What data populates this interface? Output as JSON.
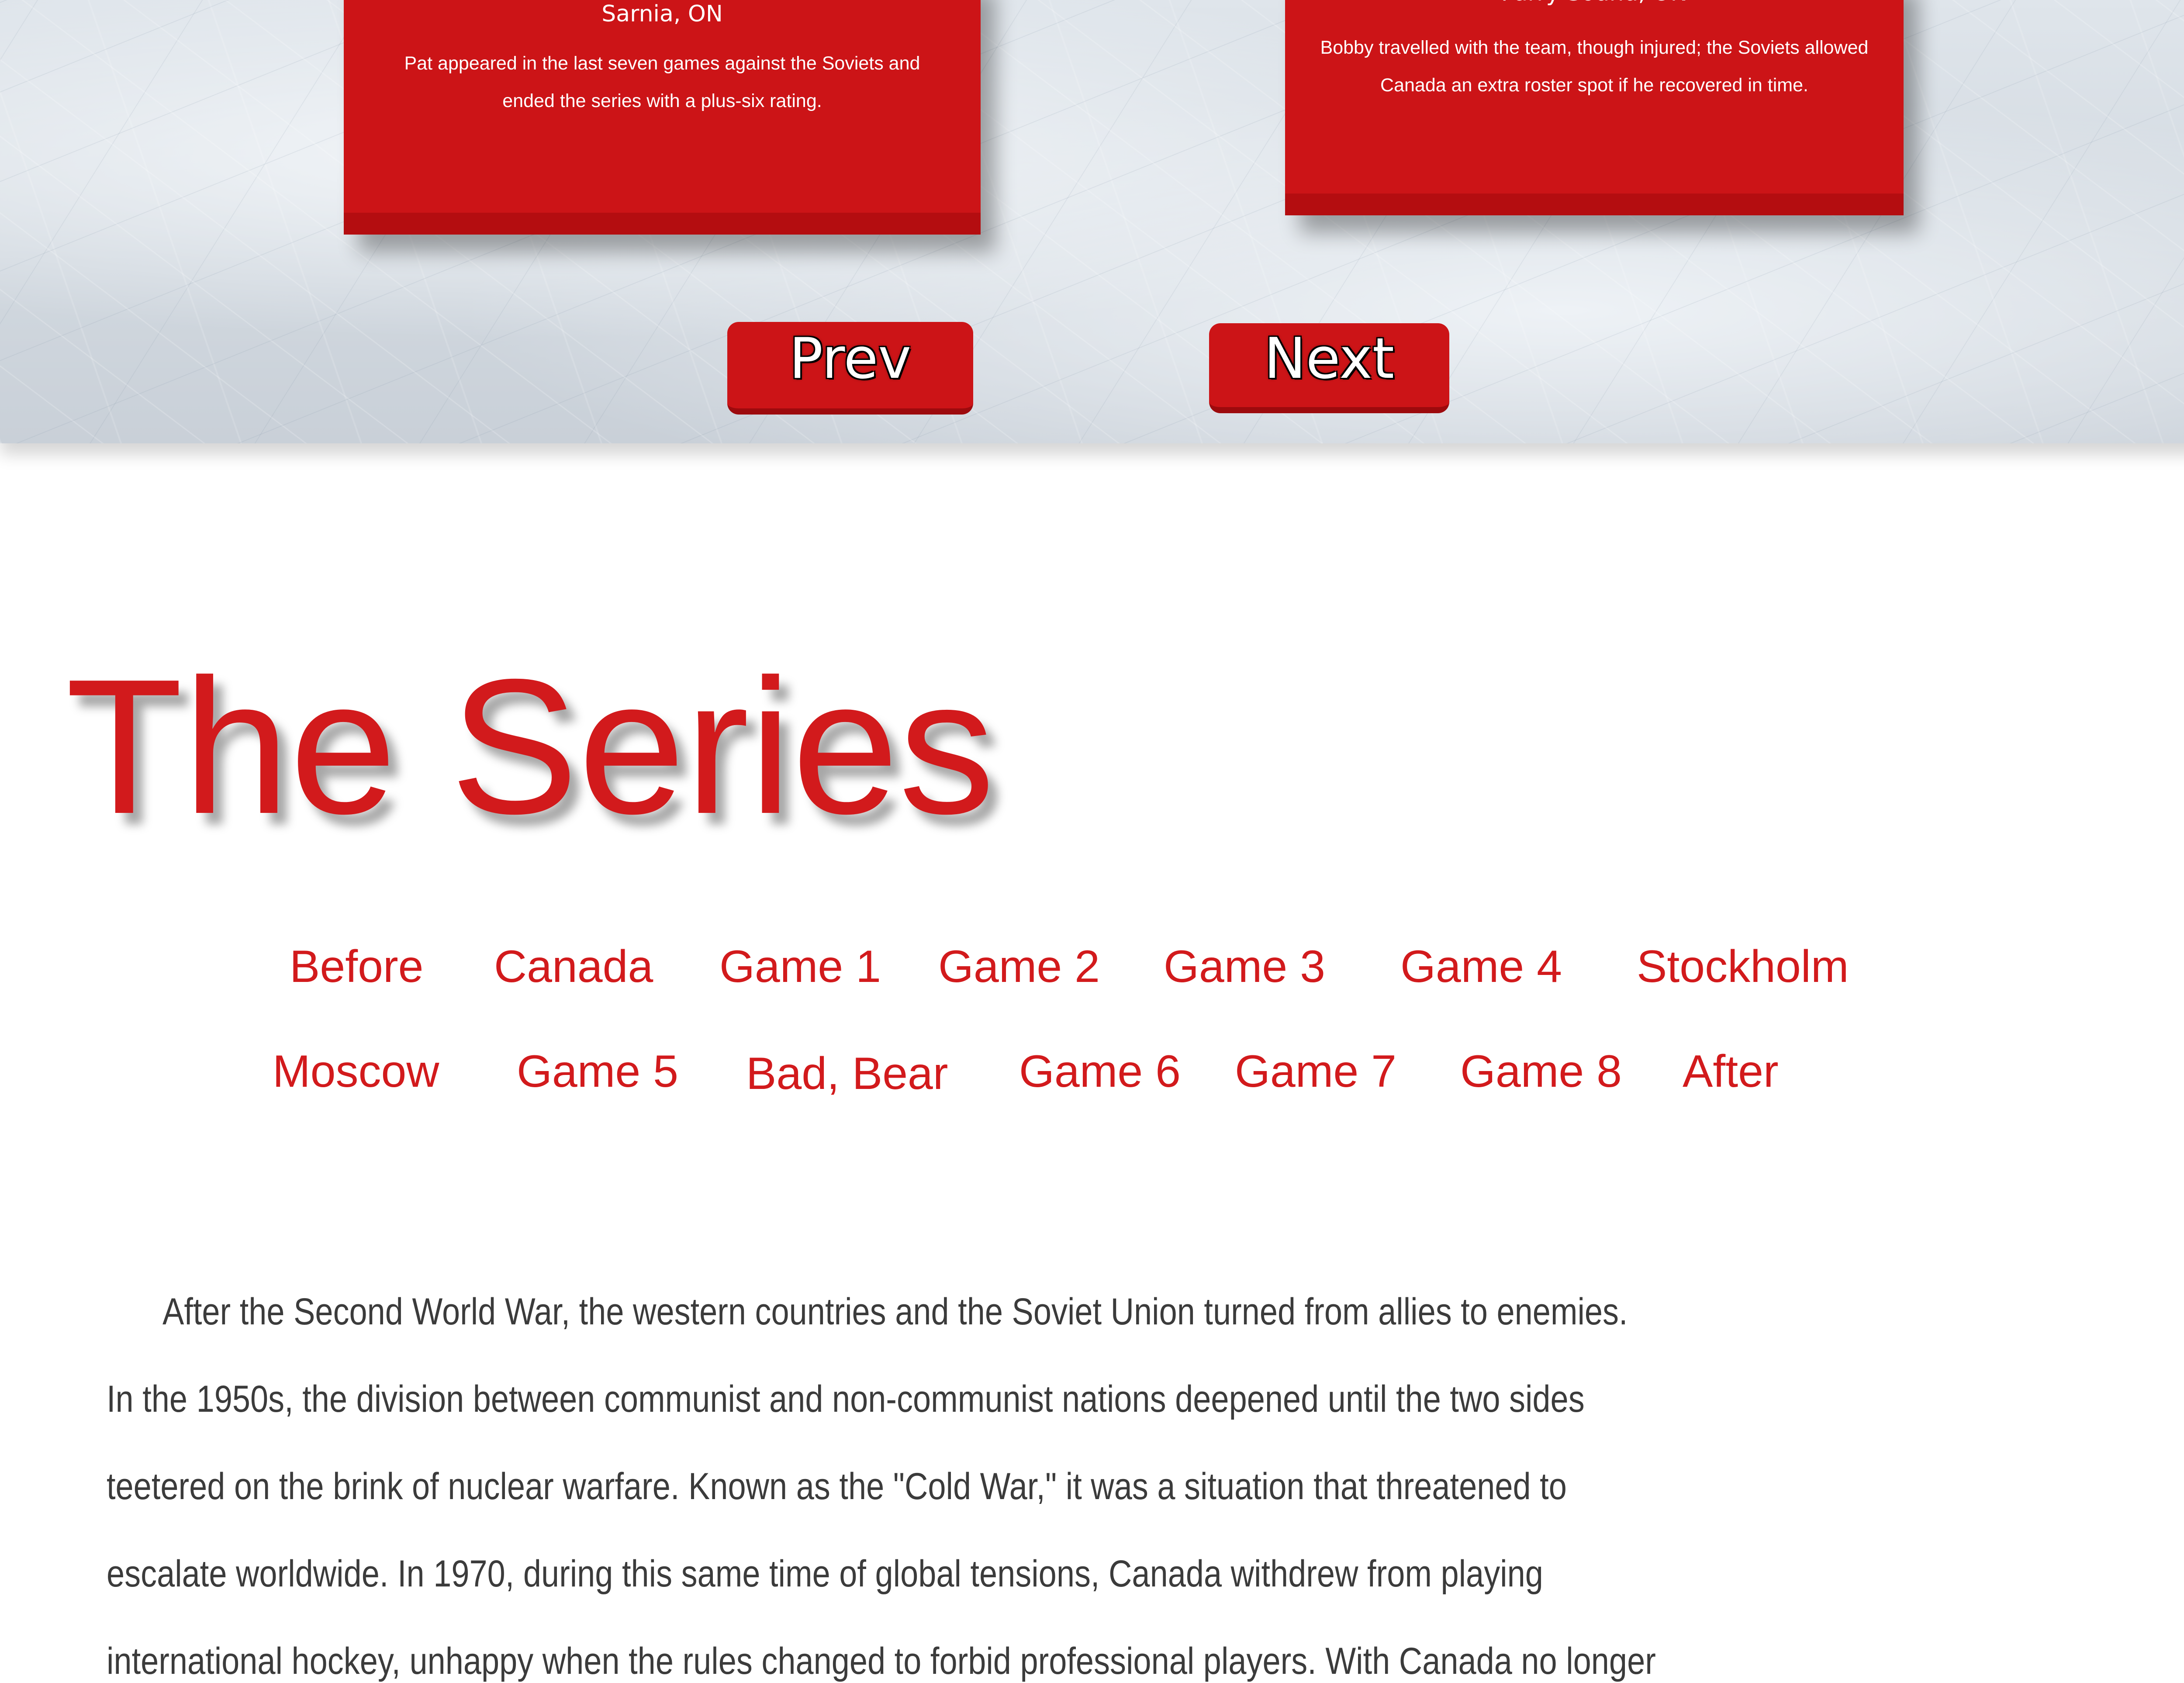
{
  "cards": [
    {
      "location": "Sarnia, ON",
      "text": "Pat appeared in the last seven games against the Soviets and ended the series with a plus-six rating."
    },
    {
      "location": "Parry Sound, ON",
      "text": "Bobby travelled with the team, though injured; the Soviets allowed Canada an extra roster spot if he recovered in time."
    }
  ],
  "pager": {
    "prev_label": "Prev",
    "next_label": "Next"
  },
  "title": "The Series",
  "nav": {
    "row1": [
      "Before",
      "Canada",
      "Game 1",
      "Game 2",
      "Game 3",
      "Game 4",
      "Stockholm"
    ],
    "row2": [
      "Moscow",
      "Game 5",
      "Bad, Bear",
      "Game 6",
      "Game 7",
      "Game 8",
      "After"
    ]
  },
  "paragraph_lines": [
    "After the Second World War, the western countries and the Soviet Union turned from allies to enemies.",
    "In the 1950s, the division between communist and non-communist nations deepened until the two sides",
    "teetered on the brink of nuclear warfare. Known as the \"Cold War,\" it was a situation that threatened to",
    "escalate worldwide.  In 1970, during this same time of global tensions, Canada withdrew from playing",
    "international hockey, unhappy when the rules changed to forbid professional players. With Canada no longer"
  ],
  "colors": {
    "accent_red": "#cc1417",
    "title_red": "#d21a1c",
    "body_text": "#3b3b3b"
  }
}
